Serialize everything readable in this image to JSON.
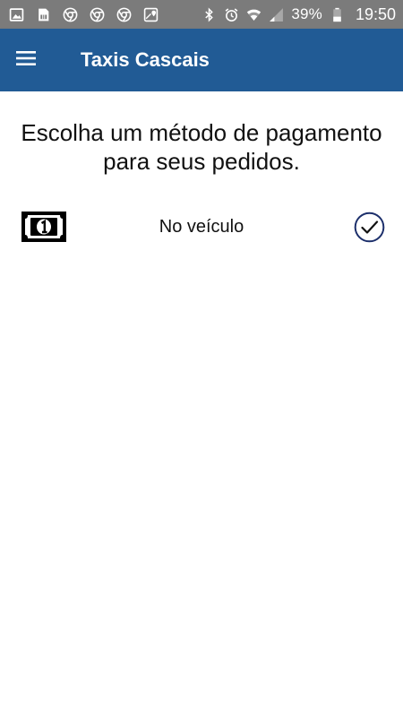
{
  "status_bar": {
    "battery_percent": "39%",
    "time": "19:50",
    "left_icons": [
      "gallery-icon",
      "sim-card-icon",
      "chrome-icon",
      "chrome-icon",
      "chrome-icon",
      "maps-icon"
    ],
    "right_icons": [
      "bluetooth-icon",
      "alarm-icon",
      "wifi-icon",
      "signal-icon",
      "battery-icon"
    ]
  },
  "app_bar": {
    "title": "Taxis Cascais",
    "menu_icon": "hamburger-menu-icon",
    "color": "#215b95"
  },
  "main": {
    "heading": "Escolha um método de pagamento para seus pedidos.",
    "payment_methods": [
      {
        "label": "No veículo",
        "icon": "cash-icon",
        "selected": true
      }
    ]
  },
  "colors": {
    "status_bar": "#7b7b7b",
    "accent": "#215b95",
    "check": "#1c2f6b"
  }
}
